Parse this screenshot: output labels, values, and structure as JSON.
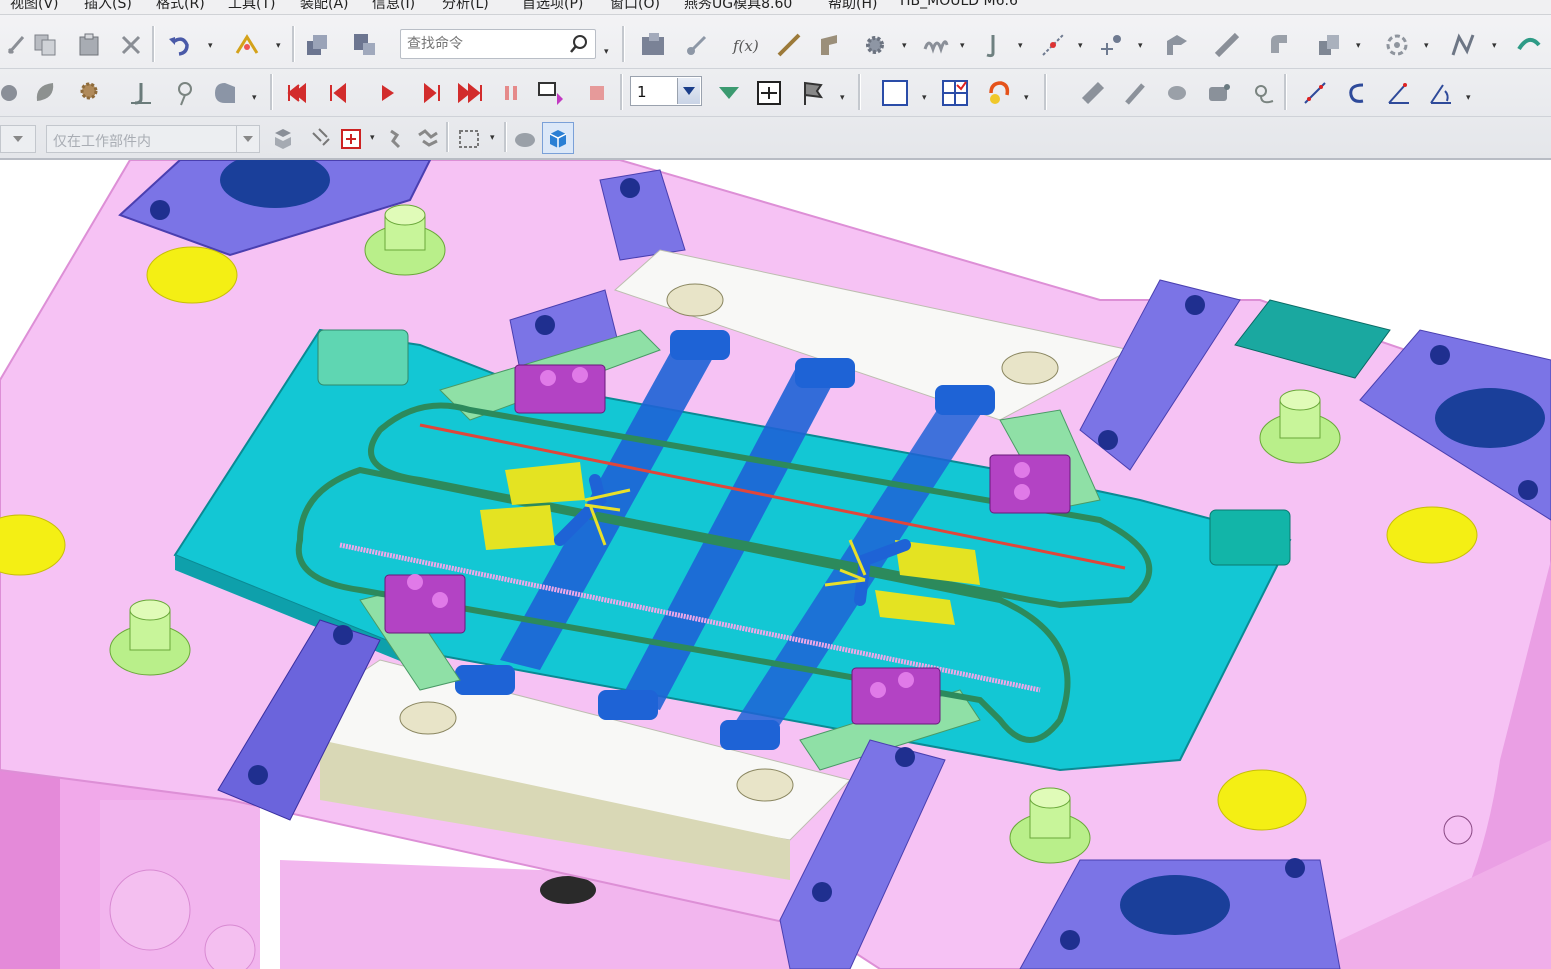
{
  "menubar": {
    "items": [
      "视图(V)",
      "插入(S)",
      "格式(R)",
      "工具(T)",
      "装配(A)",
      "信息(I)",
      "分析(L)",
      "首选项(P)",
      "窗口(O)",
      "燕秀UG模具8.60",
      "帮助(H)",
      "HB_MOULD M6.6"
    ]
  },
  "toolbar": {
    "search_placeholder": "查找命令",
    "formula_label": "f(x)",
    "step_value": "1"
  },
  "selection": {
    "filter_value": "仅在工作部件内"
  },
  "colors": {
    "plate": "#f6c2f4",
    "plate_dark": "#e79be3",
    "cavity": "#13c7d4",
    "block": "#7b74e6",
    "slider": "#8fe0a6",
    "runner": "#2c8a5c",
    "ejector": "#1e63d6",
    "guide_pin": "#b9ef8a",
    "yellow": "#f4ef14",
    "insert": "#b343c4"
  }
}
